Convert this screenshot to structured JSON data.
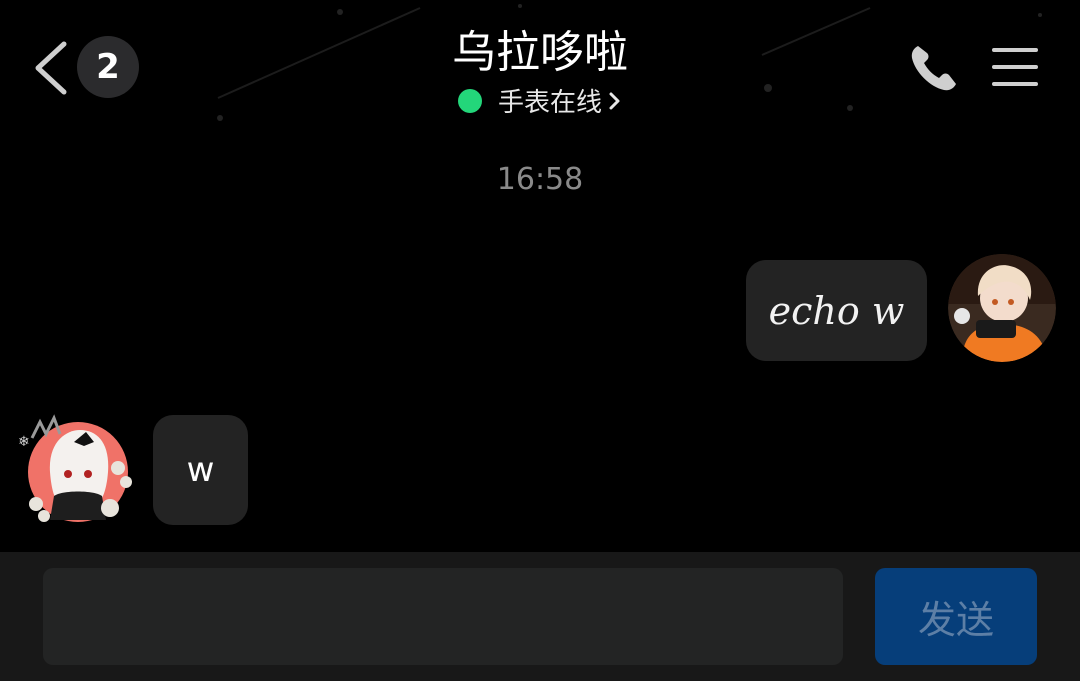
{
  "header": {
    "unread_count": "2",
    "title": "乌拉哆啦",
    "status_text": "手表在线"
  },
  "chat": {
    "timestamp": "16:58",
    "messages": [
      {
        "side": "right",
        "text": "echo w"
      },
      {
        "side": "left",
        "text": "w"
      }
    ]
  },
  "input": {
    "value": "",
    "placeholder": "",
    "send_label": "发送"
  },
  "colors": {
    "background": "#000000",
    "bubble": "#232323",
    "online_dot": "#23d67a",
    "send_button": "#063e7a",
    "send_text": "#5d7fa6"
  },
  "icons": [
    "back-chevron-icon",
    "phone-icon",
    "menu-icon",
    "chevron-right-icon"
  ]
}
